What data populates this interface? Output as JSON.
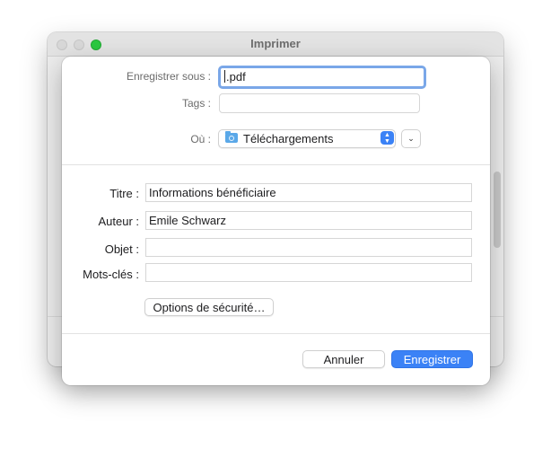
{
  "window": {
    "title": "Imprimer"
  },
  "sheet": {
    "save_as_label": "Enregistrer sous :",
    "save_as_value": ".pdf",
    "tags_label": "Tags :",
    "tags_value": "",
    "where_label": "Où :",
    "where_value": "Téléchargements",
    "fields": {
      "title_label": "Titre :",
      "title_value": "Informations bénéficiaire",
      "author_label": "Auteur :",
      "author_value": "Emile Schwarz",
      "subject_label": "Objet :",
      "subject_value": "",
      "keywords_label": "Mots-clés :",
      "keywords_value": ""
    },
    "security_button": "Options de sécurité…",
    "cancel_button": "Annuler",
    "save_button": "Enregistrer"
  },
  "colors": {
    "accent": "#3b82f6",
    "focus_ring": "#7aa7e8",
    "traffic_green": "#2ac840"
  }
}
